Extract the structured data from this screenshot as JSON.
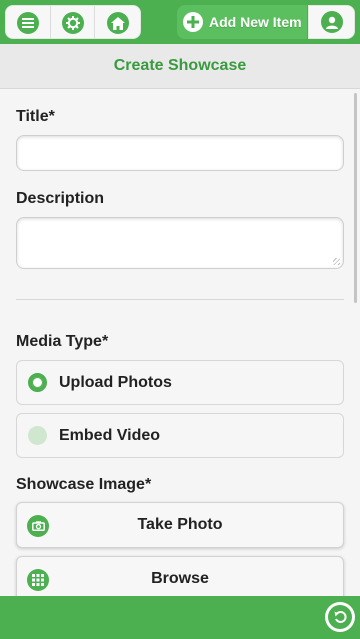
{
  "topbar": {
    "icons": [
      "menu-icon",
      "gear-icon",
      "home-icon",
      "plus-icon",
      "user-icon"
    ],
    "add_item_label": "Add New Item"
  },
  "header": {
    "title": "Create Showcase"
  },
  "form": {
    "title_label": "Title*",
    "title_value": "",
    "description_label": "Description",
    "description_value": "",
    "media_type_label": "Media Type*",
    "media_options": [
      {
        "label": "Upload Photos",
        "selected": true
      },
      {
        "label": "Embed Video",
        "selected": false
      }
    ],
    "showcase_image_label": "Showcase Image*",
    "take_photo_label": "Take Photo",
    "browse_label": "Browse"
  },
  "footer": {
    "icons": [
      "back-icon"
    ]
  },
  "colors": {
    "accent": "#4caf50",
    "header_text": "#3a9a3e"
  }
}
